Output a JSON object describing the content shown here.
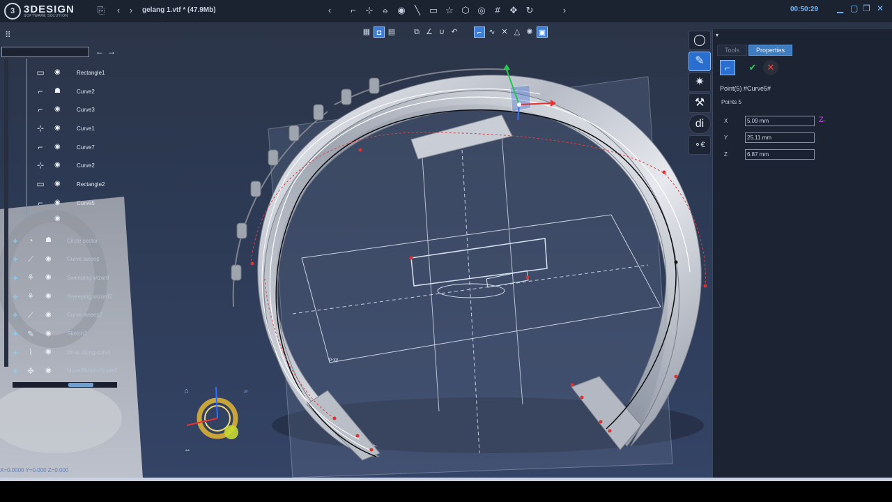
{
  "app": {
    "logo_mark": "3",
    "logo_name": "3DESIGN",
    "logo_sub": "SOFTWARE SOLUTION",
    "file_title": "gelang 1.vtf *  (47.9Mb)",
    "clock": "00:50:29"
  },
  "tree": {
    "items": [
      {
        "label": "Rectangle1",
        "icon": "rectangle-icon",
        "glyph": "▭",
        "eye": "◉"
      },
      {
        "label": "Curve2",
        "icon": "curve-icon",
        "glyph": "⌐",
        "eye": "☗"
      },
      {
        "label": "Curve3",
        "icon": "curve-icon",
        "glyph": "⌐",
        "eye": "◉"
      },
      {
        "label": "Curve1",
        "icon": "axis-curve-icon",
        "glyph": "⊹",
        "eye": "◉"
      },
      {
        "label": "Curve7",
        "icon": "curve-icon",
        "glyph": "⌐",
        "eye": "◉"
      },
      {
        "label": "Curve2",
        "icon": "axis-curve-icon",
        "glyph": "⊹",
        "eye": "◉"
      },
      {
        "label": "Rectangle2",
        "icon": "rectangle-icon",
        "glyph": "▭",
        "eye": "◉"
      },
      {
        "label": "Curve5",
        "icon": "curve-icon",
        "glyph": "⌐",
        "eye": "◉"
      },
      {
        "label": "",
        "icon": "point-icon",
        "glyph": "",
        "eye": "◉"
      }
    ],
    "groups": [
      {
        "label": "Circle sector",
        "icon": "circle-sector-icon",
        "glyph": "◔",
        "eye": "☗"
      },
      {
        "label": "Curve sweep",
        "icon": "sweep-icon",
        "glyph": "⟋",
        "eye": "◉"
      },
      {
        "label": "Sweeping wizard",
        "icon": "wizard-icon",
        "glyph": "⚘",
        "eye": "◉"
      },
      {
        "label": "Sweeping wizard2",
        "icon": "wizard-icon",
        "glyph": "⚘",
        "eye": "◉"
      },
      {
        "label": "Curve sweep2",
        "icon": "sweep-icon",
        "glyph": "⟋",
        "eye": "◉"
      },
      {
        "label": "Sketch2",
        "icon": "sketch-icon",
        "glyph": "✎",
        "eye": "◉"
      },
      {
        "label": "Wrap along curve",
        "icon": "wrap-icon",
        "glyph": "⌇",
        "eye": "◉"
      },
      {
        "label": "Move/Rotate/Scale2",
        "icon": "transform-icon",
        "glyph": "✥",
        "eye": "◉"
      }
    ]
  },
  "panel": {
    "tabs": [
      {
        "label": "Tools",
        "active": false
      },
      {
        "label": "Properties",
        "active": true
      }
    ],
    "title": "Point(5) #Curve5#",
    "points_label": "Points",
    "points_value": "5",
    "fields": [
      {
        "axis": "X",
        "value": "5.09 mm"
      },
      {
        "axis": "Y",
        "value": "25.11 mm"
      },
      {
        "axis": "Z",
        "value": "6.87 mm"
      }
    ]
  },
  "viewport": {
    "plane_label": "0-xy",
    "hud_text": "X=0.0000 Y=0.000 Z=0.000"
  },
  "colors": {
    "accent": "#3b7dd8",
    "ring": "#c8ccd4",
    "curve": "#000000",
    "control_point": "#e03030"
  }
}
